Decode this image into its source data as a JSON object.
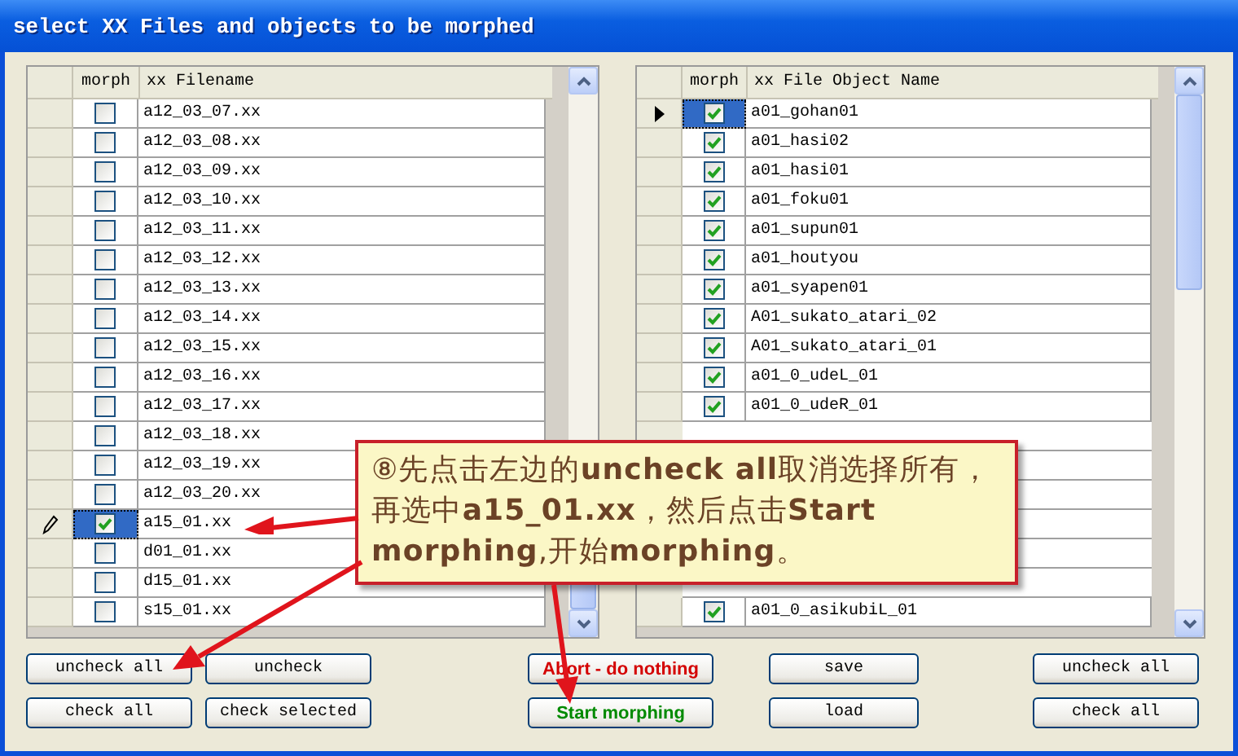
{
  "window": {
    "title": "select XX Files and objects to be morphed"
  },
  "files_table": {
    "columns": [
      "morph",
      "xx Filename"
    ],
    "rows": [
      {
        "name": "a12_03_07.xx",
        "checked": false,
        "selected": false,
        "editing": false
      },
      {
        "name": "a12_03_08.xx",
        "checked": false,
        "selected": false,
        "editing": false
      },
      {
        "name": "a12_03_09.xx",
        "checked": false,
        "selected": false,
        "editing": false
      },
      {
        "name": "a12_03_10.xx",
        "checked": false,
        "selected": false,
        "editing": false
      },
      {
        "name": "a12_03_11.xx",
        "checked": false,
        "selected": false,
        "editing": false
      },
      {
        "name": "a12_03_12.xx",
        "checked": false,
        "selected": false,
        "editing": false
      },
      {
        "name": "a12_03_13.xx",
        "checked": false,
        "selected": false,
        "editing": false
      },
      {
        "name": "a12_03_14.xx",
        "checked": false,
        "selected": false,
        "editing": false
      },
      {
        "name": "a12_03_15.xx",
        "checked": false,
        "selected": false,
        "editing": false
      },
      {
        "name": "a12_03_16.xx",
        "checked": false,
        "selected": false,
        "editing": false
      },
      {
        "name": "a12_03_17.xx",
        "checked": false,
        "selected": false,
        "editing": false
      },
      {
        "name": "a12_03_18.xx",
        "checked": false,
        "selected": false,
        "editing": false
      },
      {
        "name": "a12_03_19.xx",
        "checked": false,
        "selected": false,
        "editing": false
      },
      {
        "name": "a12_03_20.xx",
        "checked": false,
        "selected": false,
        "editing": false
      },
      {
        "name": "a15_01.xx",
        "checked": true,
        "selected": true,
        "editing": true
      },
      {
        "name": "d01_01.xx",
        "checked": false,
        "selected": false,
        "editing": false
      },
      {
        "name": "d15_01.xx",
        "checked": false,
        "selected": false,
        "editing": false
      },
      {
        "name": "s15_01.xx",
        "checked": false,
        "selected": false,
        "editing": false
      }
    ]
  },
  "objects_table": {
    "columns": [
      "morph",
      "xx File Object Name"
    ],
    "rows": [
      {
        "name": "a01_gohan01",
        "checked": true,
        "selected": true,
        "current": true
      },
      {
        "name": "a01_hasi02",
        "checked": true,
        "selected": false,
        "current": false
      },
      {
        "name": "a01_hasi01",
        "checked": true,
        "selected": false,
        "current": false
      },
      {
        "name": "a01_foku01",
        "checked": true,
        "selected": false,
        "current": false
      },
      {
        "name": "a01_supun01",
        "checked": true,
        "selected": false,
        "current": false
      },
      {
        "name": "a01_houtyou",
        "checked": true,
        "selected": false,
        "current": false
      },
      {
        "name": "a01_syapen01",
        "checked": true,
        "selected": false,
        "current": false
      },
      {
        "name": "A01_sukato_atari_02",
        "checked": true,
        "selected": false,
        "current": false
      },
      {
        "name": "A01_sukato_atari_01",
        "checked": true,
        "selected": false,
        "current": false
      },
      {
        "name": "a01_0_udeL_01",
        "checked": true,
        "selected": false,
        "current": false
      },
      {
        "name": "a01_0_udeR_01",
        "checked": true,
        "selected": false,
        "current": false
      },
      {
        "name": "a01_0_asikubiL_01",
        "checked": true,
        "selected": false,
        "current": false
      }
    ]
  },
  "left_buttons": [
    {
      "label": "uncheck all",
      "kind": "normal"
    },
    {
      "label": "uncheck",
      "kind": "normal"
    },
    {
      "label": "check all",
      "kind": "normal"
    },
    {
      "label": "check selected",
      "kind": "normal"
    }
  ],
  "middle_buttons": [
    {
      "label": "Abort - do nothing",
      "kind": "danger"
    },
    {
      "label": "save",
      "kind": "normal"
    },
    {
      "label": "Start morphing",
      "kind": "go"
    },
    {
      "label": "load",
      "kind": "normal"
    }
  ],
  "right_buttons": [
    {
      "label": "uncheck all",
      "kind": "normal"
    },
    {
      "label": "check all",
      "kind": "normal"
    }
  ],
  "callout": {
    "text": "⑧先点击左边的**uncheck all**取消选择所有，再选中**a15_01.xx**，然后点击**Start morphing**,开始**morphing**。"
  }
}
